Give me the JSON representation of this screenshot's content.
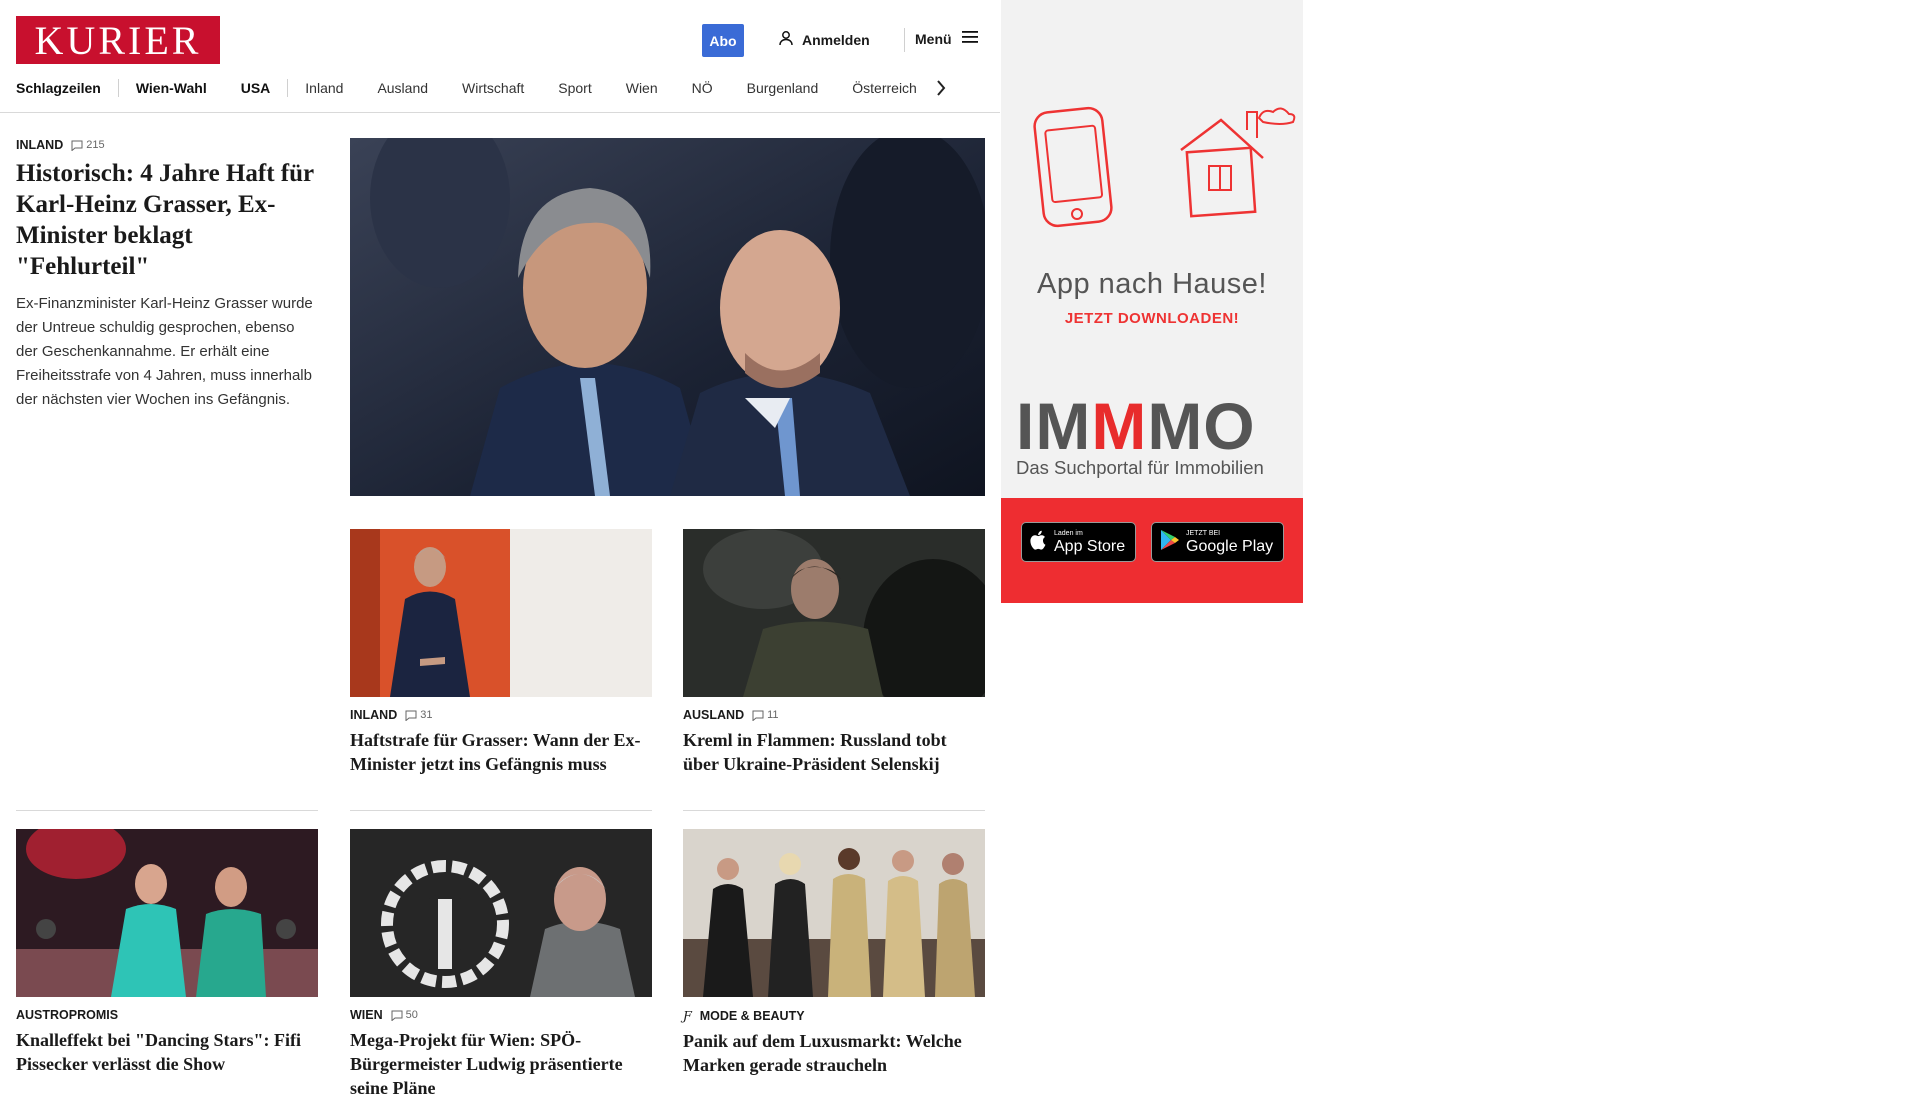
{
  "header": {
    "logo": "KURIER",
    "abo": "Abo",
    "login": "Anmelden",
    "menu": "Menü"
  },
  "nav": [
    "Schlagzeilen",
    "Wien-Wahl",
    "USA",
    "Inland",
    "Ausland",
    "Wirtschaft",
    "Sport",
    "Wien",
    "NÖ",
    "Burgenland",
    "Österreich"
  ],
  "lead": {
    "kicker": "INLAND",
    "comments": "215",
    "headline": "Historisch: 4 Jahre Haft für Karl-Heinz Grasser, Ex-Minister beklagt \"Fehlurteil\"",
    "teaser": "Ex-Finanzminister Karl-Heinz Grasser wurde der Untreue schuldig gesprochen, ebenso der Geschenkannahme. Er erhält eine Freiheitsstrafe von 4 Jahren, muss innerhalb der nächsten vier Wochen ins Gefängnis."
  },
  "cards": [
    {
      "kicker": "INLAND",
      "comments": "31",
      "headline": "Haftstrafe für Grasser: Wann der Ex-Minister jetzt ins Gefängnis muss"
    },
    {
      "kicker": "AUSLAND",
      "comments": "11",
      "headline": "Kreml in Flammen: Russland tobt über Ukraine-Präsident Selenskij"
    },
    {
      "kicker": "AUSTROPROMIS",
      "comments": "",
      "headline": "Knalleffekt bei \"Dancing Stars\": Fifi Pissecker verlässt die Show"
    },
    {
      "kicker": "WIEN",
      "comments": "50",
      "headline": "Mega-Projekt für Wien: SPÖ-Bürgermeister Ludwig präsentierte seine Pläne"
    },
    {
      "kicker": "MODE & BEAUTY",
      "comments": "",
      "headline": "Panik auf dem Luxusmarkt: Welche Marken gerade straucheln"
    }
  ],
  "ad": {
    "title": "App nach Hause!",
    "subtitle": "JETZT DOWNLOADEN!",
    "brand_a": "IM",
    "brand_m": "M",
    "brand_b": "MO",
    "brand_sub": "Das Suchportal für Immobilien",
    "appstore_small": "Laden im",
    "appstore_big": "App Store",
    "gplay_small": "JETZT BEI",
    "gplay_big": "Google Play"
  },
  "colors": {
    "brand_red": "#c8102e",
    "abo_blue": "#3a6bd6",
    "ad_red": "#ee2d31"
  }
}
